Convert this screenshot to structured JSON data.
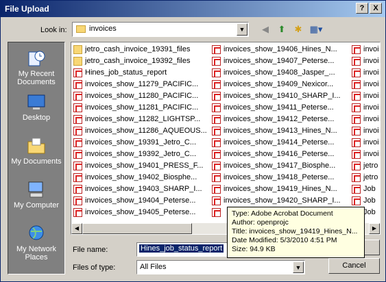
{
  "window": {
    "title": "File Upload",
    "help": "?",
    "close": "X"
  },
  "lookin": {
    "label": "Look in:",
    "value": "invoices"
  },
  "places": [
    {
      "name": "My Recent Documents"
    },
    {
      "name": "Desktop"
    },
    {
      "name": "My Documents"
    },
    {
      "name": "My Computer"
    },
    {
      "name": "My Network Places"
    }
  ],
  "files": {
    "col1": [
      {
        "name": "jetro_cash_invoice_19391_files",
        "type": "folder"
      },
      {
        "name": "jetro_cash_invoice_19392_files",
        "type": "folder"
      },
      {
        "name": "Hines_job_status_report",
        "type": "pdf"
      },
      {
        "name": "invoices_show_11279_PACIFIC...",
        "type": "pdf"
      },
      {
        "name": "invoices_show_11280_PACIFIC...",
        "type": "pdf"
      },
      {
        "name": "invoices_show_11281_PACIFIC...",
        "type": "pdf"
      },
      {
        "name": "invoices_show_11282_LIGHTSP...",
        "type": "pdf"
      },
      {
        "name": "invoices_show_11286_AQUEOUS...",
        "type": "pdf"
      },
      {
        "name": "invoices_show_19391_Jetro_C...",
        "type": "pdf"
      },
      {
        "name": "invoices_show_19392_Jetro_C...",
        "type": "pdf"
      },
      {
        "name": "invoices_show_19401_PRESS_F...",
        "type": "pdf"
      },
      {
        "name": "invoices_show_19402_Biosphe...",
        "type": "pdf"
      },
      {
        "name": "invoices_show_19403_SHARP_I...",
        "type": "pdf"
      },
      {
        "name": "invoices_show_19404_Peterse...",
        "type": "pdf"
      },
      {
        "name": "invoices_show_19405_Peterse...",
        "type": "pdf"
      }
    ],
    "col2": [
      {
        "name": "invoices_show_19406_Hines_N...",
        "type": "pdf"
      },
      {
        "name": "invoices_show_19407_Peterse...",
        "type": "pdf"
      },
      {
        "name": "invoices_show_19408_Jasper_...",
        "type": "pdf"
      },
      {
        "name": "invoices_show_19409_Nexicor...",
        "type": "pdf"
      },
      {
        "name": "invoices_show_19410_SHARP_I...",
        "type": "pdf"
      },
      {
        "name": "invoices_show_19411_Peterse...",
        "type": "pdf"
      },
      {
        "name": "invoices_show_19412_Peterse...",
        "type": "pdf"
      },
      {
        "name": "invoices_show_19413_Hines_N...",
        "type": "pdf"
      },
      {
        "name": "invoices_show_19414_Peterse...",
        "type": "pdf"
      },
      {
        "name": "invoices_show_19416_Peterse...",
        "type": "pdf"
      },
      {
        "name": "invoices_show_19417_Biosphe...",
        "type": "pdf"
      },
      {
        "name": "invoices_show_19418_Peterse...",
        "type": "pdf"
      },
      {
        "name": "invoices_show_19419_Hines_N...",
        "type": "pdf"
      },
      {
        "name": "invoices_show_19420_SHARP_I...",
        "type": "pdf"
      },
      {
        "name": "",
        "type": "pdf"
      }
    ],
    "col3": [
      {
        "name": "invoi",
        "type": "pdf"
      },
      {
        "name": "invoi",
        "type": "pdf"
      },
      {
        "name": "invoi",
        "type": "pdf"
      },
      {
        "name": "invoi",
        "type": "pdf"
      },
      {
        "name": "invoi",
        "type": "pdf"
      },
      {
        "name": "invoi",
        "type": "pdf"
      },
      {
        "name": "invoi",
        "type": "pdf"
      },
      {
        "name": "invoi",
        "type": "pdf"
      },
      {
        "name": "invoi",
        "type": "pdf"
      },
      {
        "name": "invoi",
        "type": "pdf"
      },
      {
        "name": "jetro",
        "type": "pdf"
      },
      {
        "name": "jetro",
        "type": "pdf"
      },
      {
        "name": "Job",
        "type": "pdf"
      },
      {
        "name": "Job",
        "type": "pdf"
      },
      {
        "name": "Job",
        "type": "pdf"
      }
    ]
  },
  "filename": {
    "label": "File name:",
    "value": "Hines_job_status_report"
  },
  "filetype": {
    "label": "Files of type:",
    "value": "All Files"
  },
  "buttons": {
    "cancel": "Cancel"
  },
  "tooltip": {
    "type": "Type: Adobe Acrobat Document",
    "author": "Author: openprojc",
    "title": "Title: invoices_show_19419_Hines_N...",
    "modified": "Date Modified: 5/3/2010 4:51 PM",
    "size": "Size: 94.9 KB"
  }
}
